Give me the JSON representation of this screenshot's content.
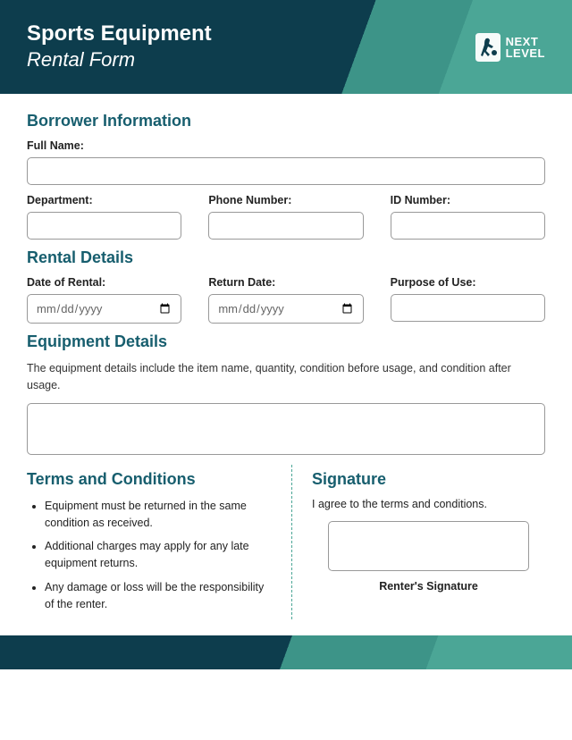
{
  "header": {
    "title": "Sports Equipment",
    "subtitle": "Rental Form",
    "logo_line1": "NEXT",
    "logo_line2": "LEVEL"
  },
  "sections": {
    "borrower": {
      "title": "Borrower Information",
      "fullname_label": "Full Name:",
      "department_label": "Department:",
      "phone_label": "Phone Number:",
      "id_label": "ID Number:"
    },
    "rental": {
      "title": "Rental Details",
      "date_label": "Date of Rental:",
      "return_label": "Return Date:",
      "purpose_label": "Purpose of Use:",
      "date_placeholder": "mm/dd/yyyy"
    },
    "equipment": {
      "title": "Equipment Details",
      "description": "The equipment details include the item name, quantity, condition before usage, and condition after usage."
    },
    "terms": {
      "title": "Terms and Conditions",
      "items": [
        "Equipment must be returned in the same condition as received.",
        "Additional charges may apply for any late equipment returns.",
        "Any damage or loss will be the responsibility of the renter."
      ]
    },
    "signature": {
      "title": "Signature",
      "agree_text": "I agree to the terms and conditions.",
      "label": "Renter's Signature"
    }
  }
}
